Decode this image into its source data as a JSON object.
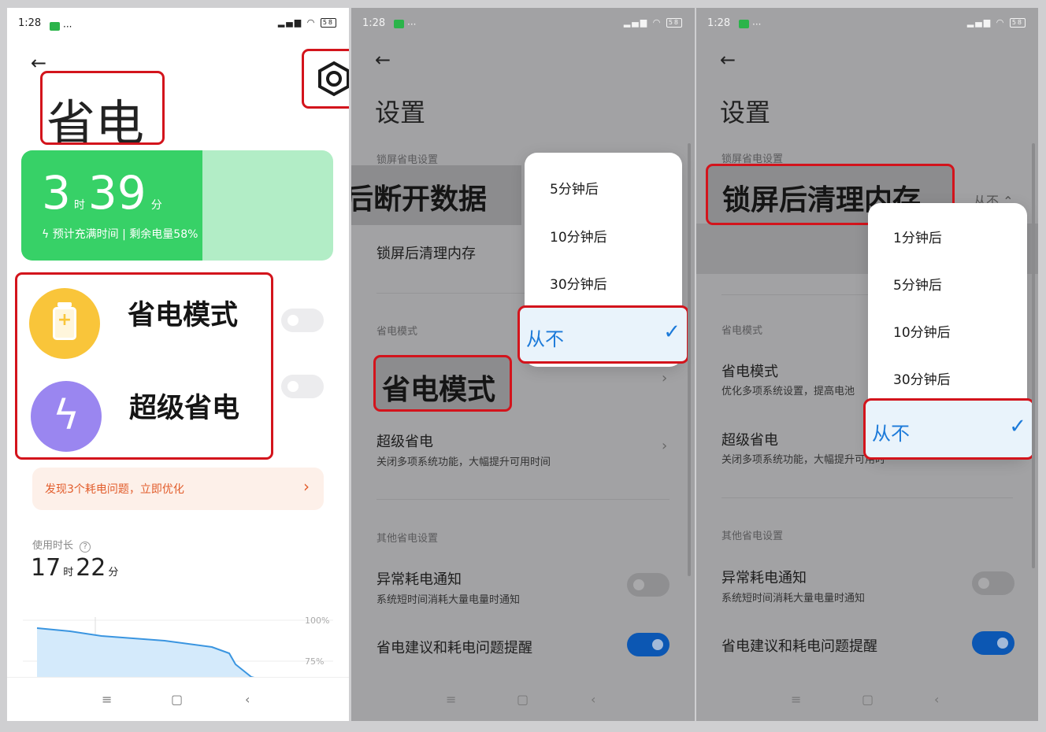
{
  "status_bar": {
    "time": "1:28",
    "dots": "···",
    "battery": "58"
  },
  "panel1": {
    "title": "省电",
    "remaining": {
      "hours": "3",
      "h_unit": "时",
      "minutes": "39",
      "m_unit": "分",
      "level": 0.58
    },
    "charge_text": "预计充满时间 | 剩余电量58%",
    "power_saving_mode": "省电模式",
    "super_saving": "超级省电",
    "issue_banner": "发现3个耗电问题，立即优化",
    "usage": {
      "label": "使用时长",
      "hours": "17",
      "h_unit": "时",
      "minutes": "22",
      "m_unit": "分"
    },
    "chart_labels": {
      "top": "100%",
      "mid": "75%"
    }
  },
  "panel2": {
    "title": "设置",
    "section_lock": "锁屏省电设置",
    "overlay_label": "锁屏后断开数据",
    "lock_clear": "锁屏后清理内存",
    "section_mode": "省电模式",
    "mode_title": "省电模式",
    "super_title": "超级省电",
    "super_sub": "关闭多项系统功能，大幅提升可用时间",
    "section_other": "其他省电设置",
    "abnormal_title": "异常耗电通知",
    "abnormal_sub": "系统短时间消耗大量电量时通知",
    "suggest_title": "省电建议和耗电问题提醒",
    "options": [
      "5分钟后",
      "10分钟后",
      "30分钟后"
    ],
    "selected": "从不"
  },
  "panel3": {
    "title": "设置",
    "section_lock": "锁屏省电设置",
    "overlay_label": "锁屏后清理内存",
    "value_hint": "从不 ⌃",
    "section_mode": "省电模式",
    "mode_title": "省电模式",
    "mode_sub": "优化多项系统设置，提高电池",
    "super_title": "超级省电",
    "super_sub": "关闭多项系统功能，大幅提升可用时",
    "section_other": "其他省电设置",
    "abnormal_title": "异常耗电通知",
    "abnormal_sub": "系统短时间消耗大量电量时通知",
    "suggest_title": "省电建议和耗电问题提醒",
    "options": [
      "1分钟后",
      "5分钟后",
      "10分钟后",
      "30分钟后"
    ],
    "selected": "从不"
  },
  "nav": {
    "menu": "≡",
    "home": "▢",
    "back": "‹"
  },
  "colors": {
    "accent_red": "#d3141c",
    "green": "#37d167",
    "blue": "#0c57b3",
    "yellow": "#f9c53a",
    "purple": "#9a86f0"
  }
}
